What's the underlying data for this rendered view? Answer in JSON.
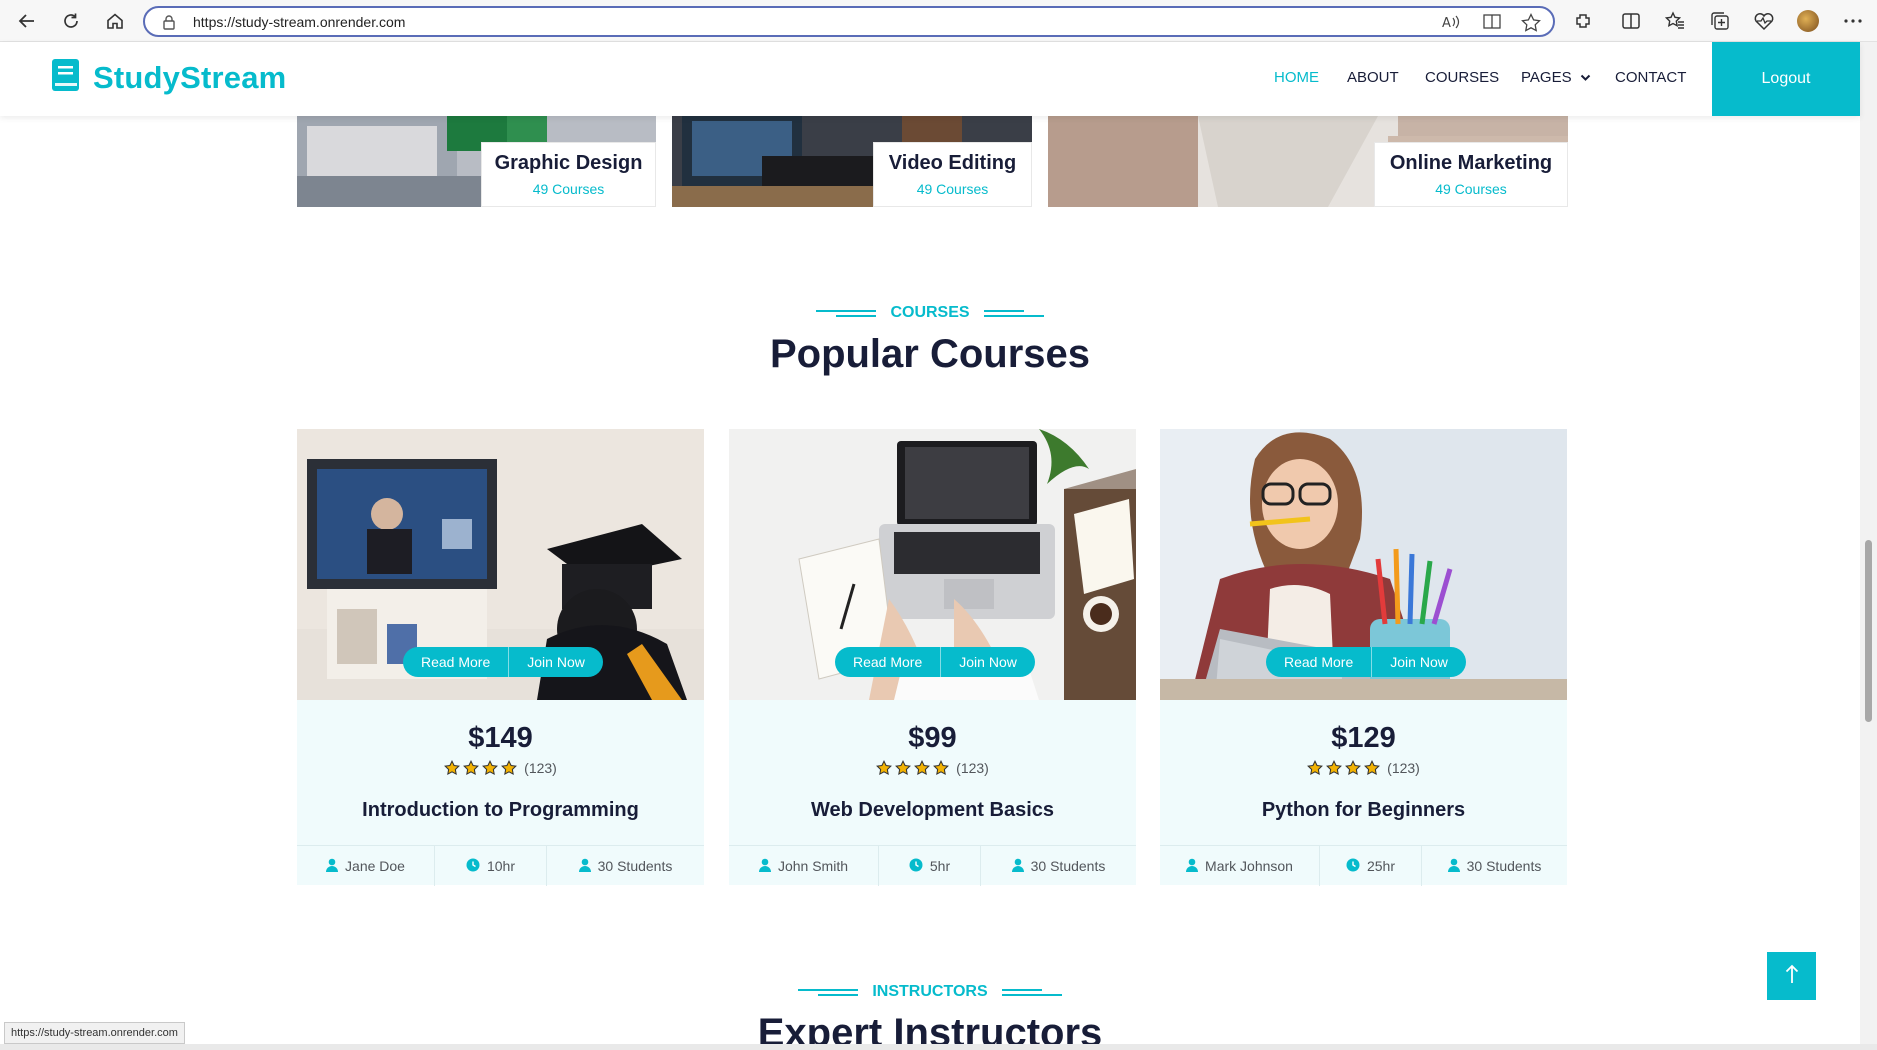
{
  "browser": {
    "url": "https://study-stream.onrender.com",
    "status_url": "https://study-stream.onrender.com"
  },
  "nav": {
    "brand": "StudyStream",
    "items": [
      {
        "label": "HOME",
        "active": true
      },
      {
        "label": "ABOUT",
        "active": false
      },
      {
        "label": "COURSES",
        "active": false
      },
      {
        "label": "PAGES",
        "active": false
      },
      {
        "label": "CONTACT",
        "active": false
      }
    ],
    "logout": "Logout"
  },
  "categories": [
    {
      "title": "Graphic Design",
      "count": "49 Courses"
    },
    {
      "title": "Video Editing",
      "count": "49 Courses"
    },
    {
      "title": "Online Marketing",
      "count": "49 Courses"
    }
  ],
  "courses_section": {
    "eyebrow": "COURSES",
    "title": "Popular Courses"
  },
  "courses": [
    {
      "price": "$149",
      "rating": 4,
      "reviews": "(123)",
      "title": "Introduction to Programming",
      "instructor": "Jane Doe",
      "duration": "10hr",
      "students": "30 Students",
      "read_more": "Read More",
      "join_now": "Join Now"
    },
    {
      "price": "$99",
      "rating": 4,
      "reviews": "(123)",
      "title": "Web Development Basics",
      "instructor": "John Smith",
      "duration": "5hr",
      "students": "30 Students",
      "read_more": "Read More",
      "join_now": "Join Now"
    },
    {
      "price": "$129",
      "rating": 4,
      "reviews": "(123)",
      "title": "Python for Beginners",
      "instructor": "Mark Johnson",
      "duration": "25hr",
      "students": "30 Students",
      "read_more": "Read More",
      "join_now": "Join Now"
    }
  ],
  "instructors_section": {
    "eyebrow": "INSTRUCTORS",
    "title": "Expert Instructors"
  },
  "colors": {
    "primary": "#06bbcc",
    "dark": "#181d38",
    "card_bg": "#f0fbfc",
    "star": "#f2b203"
  },
  "icons": [
    "back-arrow-icon",
    "reload-icon",
    "home-icon",
    "lock-icon",
    "read-aloud-icon",
    "immersive-reader-icon",
    "star-favorite-icon",
    "extensions-icon",
    "split-screen-icon",
    "favorites-icon",
    "collections-icon",
    "heart-pulse-icon",
    "more-icon",
    "book-icon",
    "chevron-down-icon",
    "user-icon",
    "clock-icon",
    "arrow-up-icon"
  ]
}
